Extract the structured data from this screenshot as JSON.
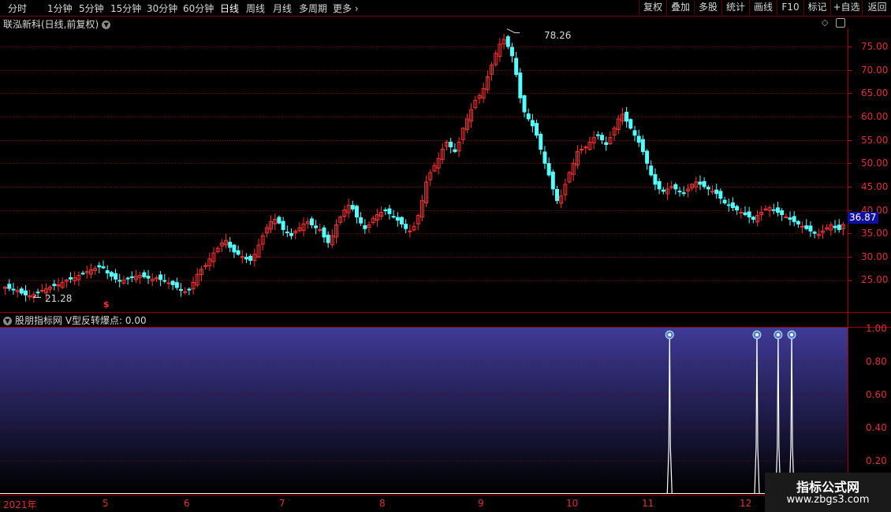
{
  "toolbar": {
    "periods": [
      "分时",
      "1分钟",
      "5分钟",
      "15分钟",
      "30分钟",
      "60分钟",
      "日线",
      "周线",
      "月线",
      "多周期",
      "更多"
    ],
    "active_period": "日线",
    "right_buttons": [
      "复权",
      "叠加",
      "多股",
      "统计",
      "画线",
      "F10",
      "标记",
      "+自选",
      "返回"
    ]
  },
  "chart_title": "联泓新科(日线,前复权)",
  "price_axis": [
    "75.00",
    "70.00",
    "65.00",
    "60.00",
    "55.00",
    "50.00",
    "45.00",
    "40.00",
    "35.00",
    "30.00",
    "25.00"
  ],
  "current_price": "36.87",
  "high_label": "78.26",
  "low_label": "21.28",
  "signal_marker": "$",
  "indicator": {
    "title": "股朋指标网 V型反转爆点: 0.00",
    "axis": [
      "1.00",
      "0.80",
      "0.60",
      "0.40",
      "0.20"
    ]
  },
  "x_axis": [
    "2021年",
    "5",
    "6",
    "7",
    "8",
    "9",
    "10",
    "11",
    "12"
  ],
  "watermark": {
    "line1": "指标公式网",
    "line2": "www.zbgs3.com"
  },
  "colors": {
    "up": "#ff3030",
    "down": "#54ffff",
    "grid": "#7a0000",
    "indicator_bg_top": "#3f3a96",
    "indicator_bg_bottom": "#000000"
  },
  "chart_data": {
    "type": "candlestick",
    "title": "联泓新科(日线,前复权)",
    "ylim": [
      20,
      80
    ],
    "high": 78.26,
    "low": 21.28,
    "last": 36.87,
    "closes": [
      23.5,
      23.2,
      23,
      22.8,
      22.2,
      21.8,
      21.6,
      21.9,
      22.4,
      22.8,
      23.1,
      23.5,
      23.8,
      24,
      24.5,
      25,
      25.2,
      25.5,
      26,
      26.3,
      26.8,
      27.2,
      27.5,
      27.8,
      27.6,
      26.5,
      25.8,
      25.2,
      24.8,
      25,
      25.3,
      25.6,
      25.8,
      26,
      25.7,
      25.4,
      25.2,
      25.5,
      25.1,
      24.8,
      24.4,
      24,
      23.4,
      22.8,
      22.5,
      22.9,
      24.5,
      26.2,
      27.3,
      28.1,
      29.5,
      30.8,
      31.8,
      32.9,
      33.5,
      32,
      31,
      30.5,
      30,
      29.5,
      29.2,
      30.5,
      32.5,
      34.5,
      36.2,
      37.5,
      38,
      37.2,
      35.8,
      35.2,
      34.5,
      35.5,
      36.2,
      37,
      37.5,
      36.8,
      36.2,
      35.8,
      34.2,
      33,
      34.5,
      36.8,
      38.5,
      40,
      41,
      40.2,
      38.5,
      37.2,
      36,
      36.8,
      38.2,
      39,
      39.5,
      40,
      39.2,
      38.5,
      37.8,
      37,
      36,
      35.5,
      36.5,
      38.8,
      42,
      46,
      48,
      49.5,
      51,
      53,
      54.5,
      53.5,
      52.5,
      54.5,
      57.5,
      59.5,
      61.5,
      63.5,
      64.5,
      66,
      68.5,
      71,
      73.5,
      75.5,
      76.5,
      75,
      73,
      69,
      64,
      61,
      59.5,
      58,
      56,
      53,
      50,
      47.5,
      44.5,
      42,
      43,
      45.5,
      48,
      50,
      52.5,
      53,
      53.5,
      54.5,
      55.5,
      56,
      55,
      54,
      55.5,
      57.5,
      59.5,
      60.5,
      59,
      57.5,
      56,
      54.5,
      52.5,
      50,
      47.5,
      45.5,
      44.5,
      44,
      44.5,
      45,
      44.5,
      44,
      43.5,
      44.5,
      45.5,
      46,
      45.5,
      45,
      44.5,
      44,
      43.5,
      42.5,
      41.5,
      41,
      40.5,
      40,
      39.5,
      39,
      38.5,
      38,
      38.8,
      39.5,
      40.2,
      40.5,
      40,
      39.5,
      39,
      38.5,
      38,
      37.5,
      37,
      36.5,
      36,
      35.5,
      35,
      34.8,
      35.5,
      36.2,
      36.8,
      36.2,
      35.8,
      36.87
    ],
    "signals_at": [
      0.79,
      0.893,
      0.918,
      0.934
    ],
    "indicator_series": "V型反转爆点",
    "indicator_ylim": [
      0,
      1
    ]
  }
}
